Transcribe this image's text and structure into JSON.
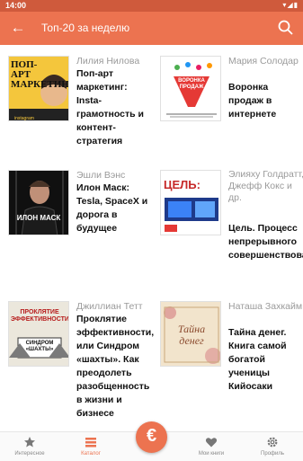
{
  "status": {
    "time": "14:00",
    "system_icons": "▾◢▮"
  },
  "appbar": {
    "title": "Топ-20 за неделю"
  },
  "books": [
    {
      "author": "Лилия Нилова",
      "title": "Поп-арт маркетинг: Insta-грамотность и контент-стратегия",
      "cover_text": "ПОП-АРТ МАРКЕТИНГ"
    },
    {
      "author": "Мария Солодар",
      "title": "Воронка продаж в интернете",
      "cover_text": "ВОРОНКА ПРОДАЖ"
    },
    {
      "author": "Эшли Вэнс",
      "title": "Илон Маск: Tesla, SpaceX и дорога в будущее",
      "cover_text": "ИЛОН МАСК"
    },
    {
      "author": "Элияху Голдратт, Джефф Кокс и др.",
      "title": "Цель. Процесс непрерывного совершенствования",
      "cover_text": "ЦЕЛЬ:"
    },
    {
      "author": "Джиллиан Тетт",
      "title": "Проклятие эффективности, или Синдром «шахты». Как преодолеть разобщенность в жизни и бизнесе",
      "cover_text": "ПРОКЛЯТИЕ ЭФФЕКТИВНОСТИ",
      "cover_text2": "СИНДРОМ «ШАХТЫ»"
    },
    {
      "author": "Наташа Захкайм",
      "title": "Тайна денег. Книга самой богатой ученицы Кийосаки",
      "cover_text": "Тайна денег"
    }
  ],
  "nav": {
    "items": [
      {
        "label": "Интересное",
        "icon": "star-icon"
      },
      {
        "label": "Каталог",
        "icon": "catalog-icon"
      },
      {
        "label": "Мои книги",
        "icon": "heart-icon"
      },
      {
        "label": "Профиль",
        "icon": "gear-icon"
      }
    ],
    "fab_symbol": "€"
  },
  "colors": {
    "accent": "#ec7350",
    "statusbar": "#cf5a3c"
  }
}
